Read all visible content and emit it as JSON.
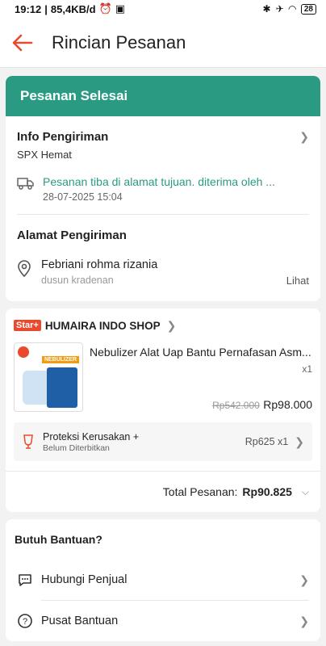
{
  "status": {
    "time": "19:12",
    "speed": "85,4KB/d",
    "battery": "28"
  },
  "header": {
    "title": "Rincian Pesanan"
  },
  "order_status": {
    "label": "Pesanan Selesai"
  },
  "shipping": {
    "title": "Info Pengiriman",
    "courier": "SPX Hemat",
    "tracking_text": "Pesanan tiba di alamat tujuan. diterima oleh ...",
    "tracking_time": "28-07-2025 15:04"
  },
  "address": {
    "title": "Alamat Pengiriman",
    "name": "Febriani rohma rizania",
    "line": "dusun kradenan",
    "more": "Lihat"
  },
  "shop": {
    "badge": "Star+",
    "name": "HUMAIRA INDO SHOP"
  },
  "product": {
    "name": "Nebulizer Alat Uap Bantu Pernafasan Asm...",
    "qty": "x1",
    "old_price": "Rp542.000",
    "price": "Rp98.000",
    "thumb_brand": "NEBULIZER"
  },
  "protection": {
    "title": "Proteksi Kerusakan +",
    "subtitle": "Belum Diterbitkan",
    "price": "Rp625 x1"
  },
  "total": {
    "label": "Total Pesanan:",
    "value": "Rp90.825"
  },
  "help": {
    "title": "Butuh Bantuan?",
    "items": [
      {
        "label": "Hubungi Penjual"
      },
      {
        "label": "Pusat Bantuan"
      }
    ]
  },
  "colors": {
    "accent": "#2a9a83",
    "brand": "#e94a2e"
  }
}
